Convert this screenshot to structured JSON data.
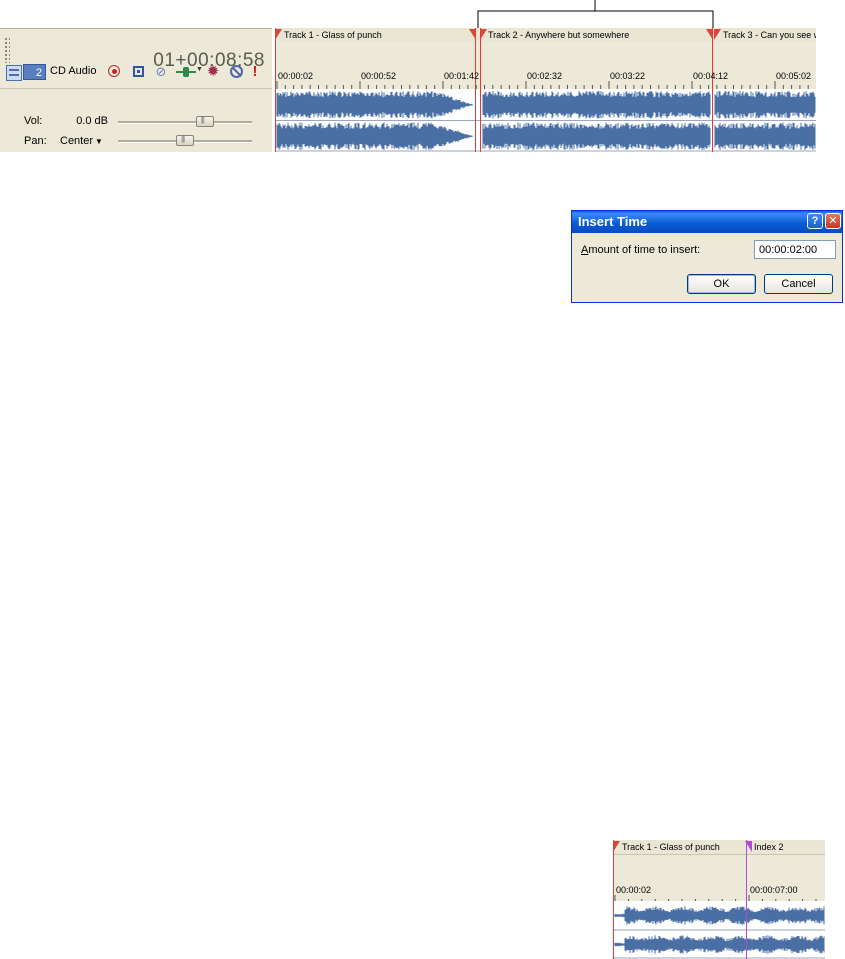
{
  "editor": {
    "timecode": "01+00:08:58",
    "track": {
      "number": "2",
      "name": "CD Audio",
      "vol_label": "Vol:",
      "vol_value": "0.0 dB",
      "pan_label": "Pan:",
      "pan_value": "Center",
      "volume_level": 0.67,
      "pan_level": 0.5
    },
    "markers": [
      {
        "label": "Track 1 - Glass of punch"
      },
      {
        "label": "Track 2 - Anywhere but somewhere"
      },
      {
        "label": "Track 3 - Can you see w"
      }
    ],
    "ruler_ticks": [
      "00:00:02",
      "00:00:52",
      "00:01:42",
      "00:02:32",
      "00:03:22",
      "00:04:12",
      "00:05:02"
    ],
    "icons": [
      "track-layout-icon",
      "record-arm-icon",
      "monitor-icon",
      "invert-phase-icon",
      "track-fx-icon",
      "automation-gear-icon",
      "mute-icon",
      "solo-icon"
    ],
    "colors": {
      "marker": "#d9463c",
      "waveform": "#4a6fa5",
      "track_number_bg": "#5a7fbf"
    }
  },
  "dialog": {
    "title": "Insert Time",
    "amount_label_prefix": "A",
    "amount_label_rest": "mount of time to insert:",
    "amount_value": "00:00:02:00",
    "ok_label": "OK",
    "cancel_label": "Cancel",
    "help_glyph": "?",
    "close_glyph": "✕",
    "colors": {
      "titlebar": "#0a5cd8"
    }
  },
  "mini": {
    "track_marker": "Track 1 - Glass of punch",
    "index_marker": "Index 2",
    "ruler_ticks": [
      "00:00:02",
      "00:00:07:00"
    ],
    "colors": {
      "index": "#b04dd8"
    }
  }
}
